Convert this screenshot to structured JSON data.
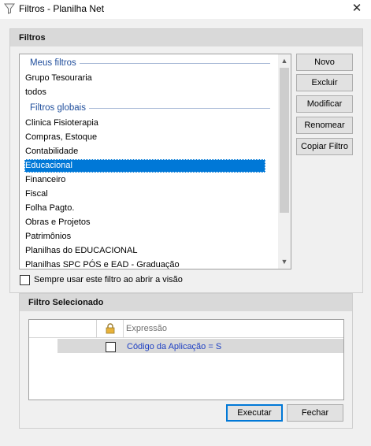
{
  "window": {
    "title": "Filtros - Planilha Net",
    "close_glyph": "✕",
    "icon": "filter-funnel-icon"
  },
  "filters_panel": {
    "header": "Filtros",
    "groups": [
      {
        "label": "Meus filtros",
        "items": [
          "Grupo Tesouraria",
          "todos"
        ]
      },
      {
        "label": "Filtros globais",
        "items": [
          "Clinica Fisioterapia",
          "Compras, Estoque",
          "Contabilidade",
          "Educacional",
          "Financeiro",
          "Fiscal",
          "Folha Pagto.",
          "Obras e Projetos",
          "Patrimônios",
          "Planilhas do EDUCACIONAL",
          "Planilhas SPC PÓS e EAD - Graduação"
        ]
      }
    ],
    "selected_item": "Educacional",
    "buttons": {
      "novo": "Novo",
      "excluir": "Excluir",
      "modificar": "Modificar",
      "renomear": "Renomear",
      "copiar": "Copiar Filtro"
    },
    "always_use_label": "Sempre usar este filtro ao abrir a visão",
    "always_use_checked": false
  },
  "selected_filter": {
    "header": "Filtro Selecionado",
    "columns": {
      "lock_icon": "lock-icon",
      "expression": "Expressão"
    },
    "rows": [
      {
        "checked": false,
        "expression": "Código da Aplicação  = S"
      }
    ]
  },
  "footer": {
    "execute_label": "Executar",
    "close_label": "Fechar"
  },
  "colors": {
    "selection": "#0078d7",
    "group_label": "#1f4e9c",
    "expression_text": "#1d3fc3"
  }
}
